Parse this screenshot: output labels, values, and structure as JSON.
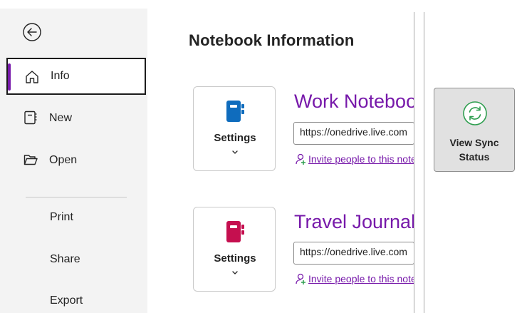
{
  "sidebar": {
    "items": [
      {
        "label": "Info",
        "icon": "home-icon",
        "selected": true
      },
      {
        "label": "New",
        "icon": "new-page-icon"
      },
      {
        "label": "Open",
        "icon": "folder-open-icon"
      }
    ],
    "secondary": [
      {
        "label": "Print"
      },
      {
        "label": "Share"
      },
      {
        "label": "Export"
      }
    ]
  },
  "main": {
    "title": "Notebook Information",
    "notebooks": [
      {
        "name": "Work Notebook",
        "color": "#0f6cbd",
        "settings_label": "Settings",
        "url": "https://onedrive.live.com",
        "invite": "Invite people to this notebook"
      },
      {
        "name": "Travel Journal",
        "color": "#c50f4f",
        "settings_label": "Settings",
        "url": "https://onedrive.live.com",
        "invite": "Invite people to this notebook"
      }
    ]
  },
  "sync": {
    "line1": "View Sync",
    "line2": "Status",
    "icon": "sync-icon",
    "icon_color": "#2e9e4f"
  },
  "colors": {
    "accent": "#7719aa",
    "sidebar_bg": "#f3f3f3"
  }
}
